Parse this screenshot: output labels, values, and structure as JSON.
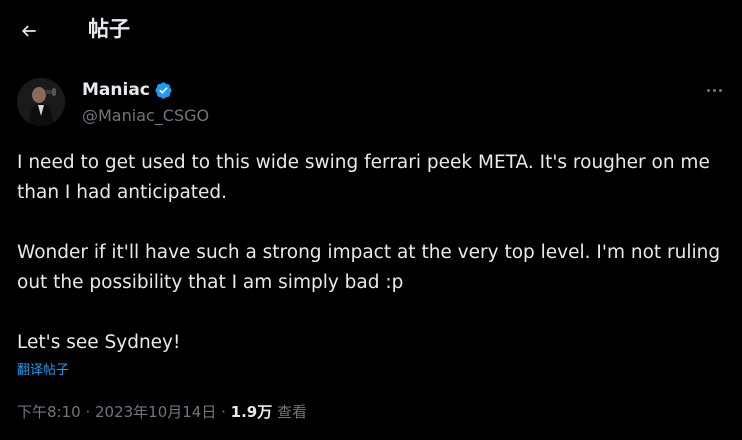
{
  "header": {
    "back_icon": "arrow-left-icon",
    "title": "帖子"
  },
  "author": {
    "name": "Maniac",
    "handle": "@Maniac_CSGO",
    "verified": true,
    "verified_color": "#1d9bf0"
  },
  "tweet": {
    "paragraphs": [
      "I need to get used to this wide swing ferrari peek META. It's rougher on me than I had anticipated.",
      "Wonder if it'll have such a strong impact at the very top level. I'm not ruling out the possibility that I am simply bad :p",
      "Let's see Sydney!"
    ],
    "translate_label": "翻译帖子"
  },
  "meta": {
    "time": "下午8:10",
    "separator1": " · ",
    "date": "2023年10月14日",
    "separator2": " · ",
    "views_count": "1.9万",
    "views_label": " 查看"
  },
  "colors": {
    "background": "#000000",
    "text": "#e7e9ea",
    "secondary": "#71767b",
    "accent": "#1d9bf0"
  }
}
